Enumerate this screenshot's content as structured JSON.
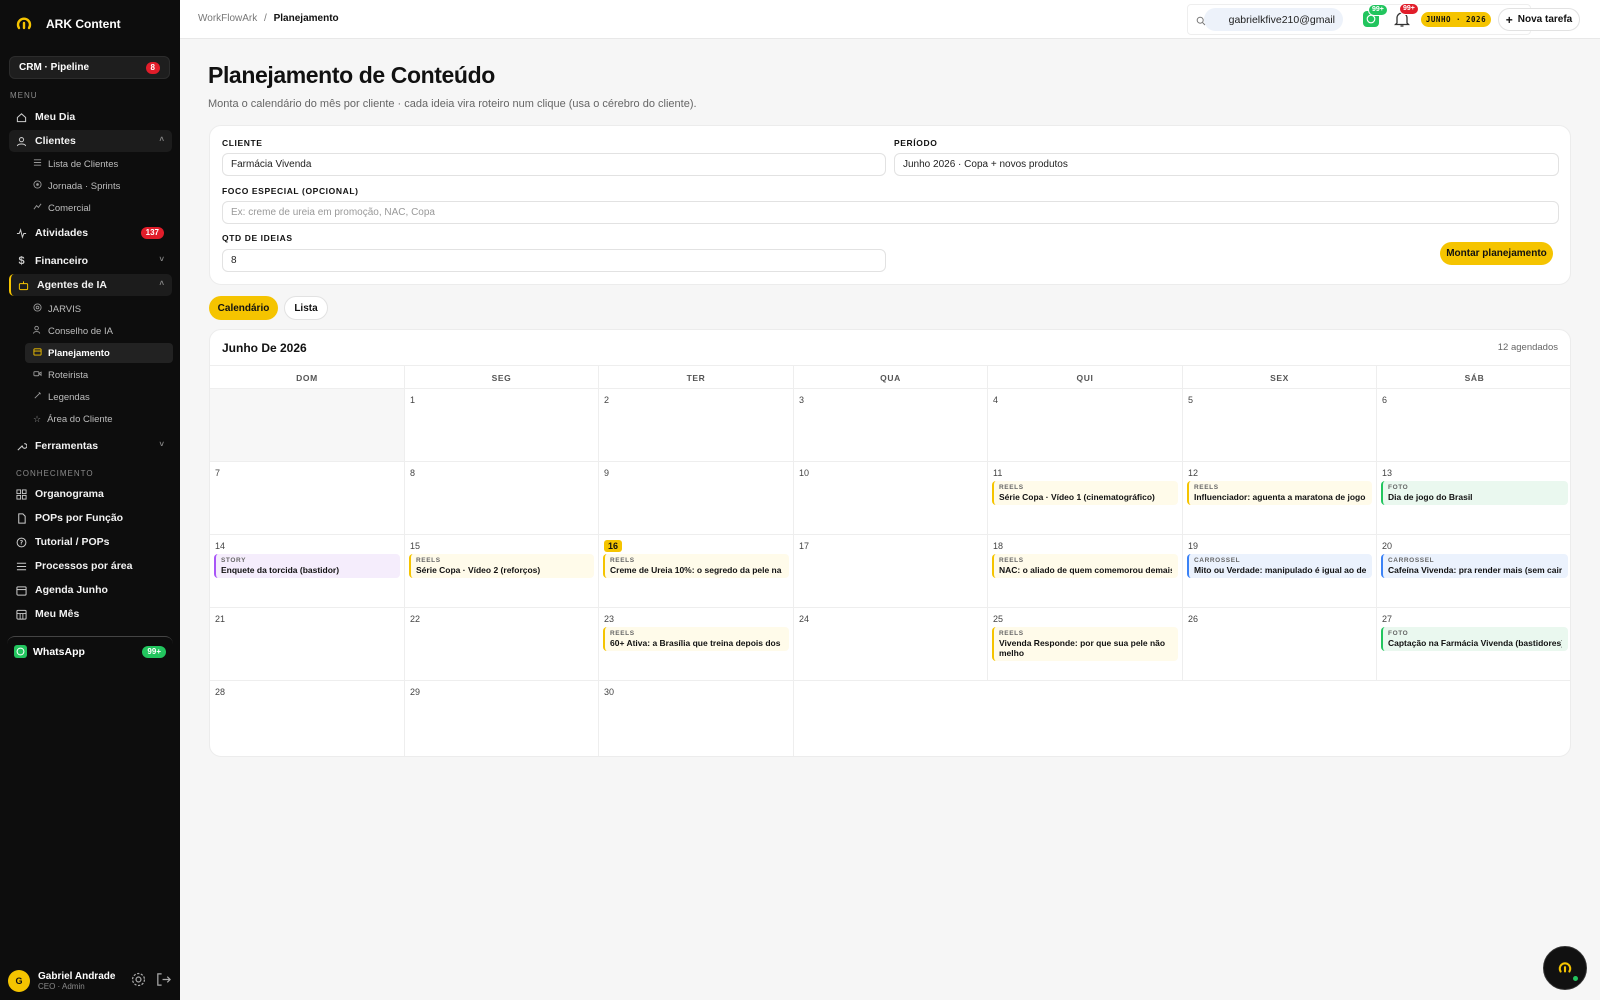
{
  "brand": {
    "name": "ARK Content"
  },
  "crm": {
    "label": "CRM · Pipeline",
    "badge": "8"
  },
  "sidebar": {
    "menu_label": "MENU",
    "knowledge_label": "CONHECIMENTO",
    "items": {
      "meu_dia": "Meu Dia",
      "clientes": "Clientes",
      "lista_clientes": "Lista de Clientes",
      "jornada": "Jornada · Sprints",
      "comercial": "Comercial",
      "atividades": "Atividades",
      "atividades_badge": "137",
      "financeiro": "Financeiro",
      "agentes": "Agentes de IA",
      "jarvis": "JARVIS",
      "conselho": "Conselho de IA",
      "planejamento": "Planejamento",
      "roteirista": "Roteirista",
      "legendas": "Legendas",
      "area_cliente": "Área do Cliente",
      "ferramentas": "Ferramentas",
      "organograma": "Organograma",
      "pops_funcao": "POPs por Função",
      "tutorial": "Tutorial / POPs",
      "processos": "Processos por área",
      "agenda": "Agenda Junho",
      "meu_mes": "Meu Mês"
    },
    "whatsapp": {
      "label": "WhatsApp",
      "badge": "99+"
    },
    "user": {
      "initial": "G",
      "name": "Gabriel Andrade",
      "role": "CEO · Admin"
    }
  },
  "topbar": {
    "crumb_root": "WorkFlowArk",
    "crumb_sep": "/",
    "crumb_current": "Planejamento",
    "email": "gabrielkfive210@gmail",
    "wa_count": "99+",
    "bell_count": "99+",
    "month_pill": "JUNHO · 2026",
    "new_task": "Nova tarefa"
  },
  "page": {
    "title": "Planejamento de Conteúdo",
    "subtitle": "Monta o calendário do mês por cliente · cada ideia vira roteiro num clique (usa o cérebro do cliente)."
  },
  "form": {
    "cliente_label": "CLIENTE",
    "cliente_value": "Farmácia Vivenda",
    "periodo_label": "PERÍODO",
    "periodo_value": "Junho 2026 · Copa + novos produtos",
    "foco_label": "FOCO ESPECIAL (OPCIONAL)",
    "foco_placeholder": "Ex: creme de ureia em promoção, NAC, Copa",
    "qtd_label": "QTD DE IDEIAS",
    "qtd_value": "8",
    "submit": "Montar planejamento"
  },
  "tabs": {
    "calendar": "Calendário",
    "list": "Lista"
  },
  "calendar": {
    "title": "Junho De 2026",
    "count": "12 agendados",
    "weekdays": [
      "DOM",
      "SEG",
      "TER",
      "QUA",
      "QUI",
      "SEX",
      "SÁB"
    ],
    "days": {
      "d1": "1",
      "d2": "2",
      "d3": "3",
      "d4": "4",
      "d5": "5",
      "d6": "6",
      "d7": "7",
      "d8": "8",
      "d9": "9",
      "d10": "10",
      "d11": "11",
      "d12": "12",
      "d13": "13",
      "d14": "14",
      "d15": "15",
      "d16": "16",
      "d17": "17",
      "d18": "18",
      "d19": "19",
      "d20": "20",
      "d21": "21",
      "d22": "22",
      "d23": "23",
      "d24": "24",
      "d25": "25",
      "d26": "26",
      "d27": "27",
      "d28": "28",
      "d29": "29",
      "d30": "30"
    },
    "events": {
      "e11": {
        "type": "REELS",
        "title": "Série Copa · Vídeo 1 (cinematográfico)"
      },
      "e12": {
        "type": "REELS",
        "title": "Influenciador: aguenta a maratona de jogos?"
      },
      "e13": {
        "type": "FOTO",
        "title": "Dia de jogo do Brasil"
      },
      "e14": {
        "type": "STORY",
        "title": "Enquete da torcida (bastidor)"
      },
      "e15": {
        "type": "REELS",
        "title": "Série Copa · Vídeo 2 (reforços)"
      },
      "e16": {
        "type": "REELS",
        "title": "Creme de Ureia 10%: o segredo da pele na sec"
      },
      "e18": {
        "type": "REELS",
        "title": "NAC: o aliado de quem comemorou demais"
      },
      "e19": {
        "type": "CARROSSEL",
        "title": "Mito ou Verdade: manipulado é igual ao de fa"
      },
      "e20": {
        "type": "CARROSSEL",
        "title": "Cafeína Vivenda: pra render mais (sem cair à"
      },
      "e23": {
        "type": "REELS",
        "title": "60+ Ativa: a Brasília que treina depois dos"
      },
      "e25": {
        "type": "REELS",
        "title": "Vivenda Responde: por que sua pele não melho"
      },
      "e27": {
        "type": "FOTO",
        "title": "Captação na Farmácia Vivenda (bastidores)"
      }
    }
  },
  "colors": {
    "accent": "#f5c400",
    "sidebar_bg": "#0d0d0d",
    "danger": "#e11d2a",
    "success": "#22c55e",
    "story": "#a855f7",
    "carrossel": "#3b82f6"
  }
}
